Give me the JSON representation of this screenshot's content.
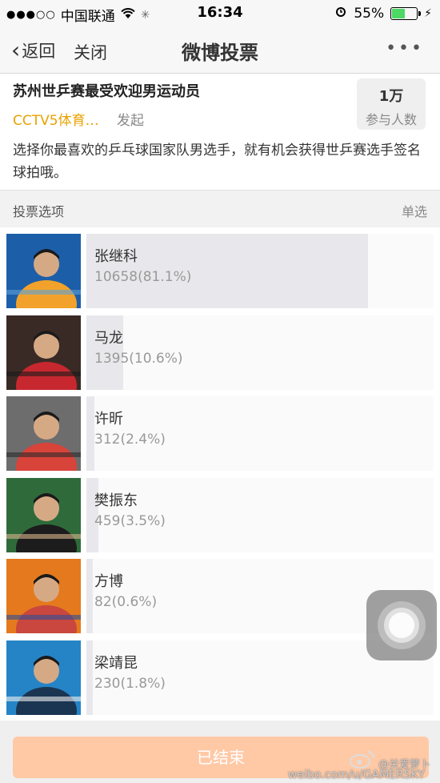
{
  "status_bar": {
    "carrier": "中国联通",
    "time": "16:34",
    "battery_percent": "55%",
    "battery_level": 0.55
  },
  "nav": {
    "back_label": "返回",
    "close_label": "关闭",
    "title": "微博投票",
    "more_label": "•••"
  },
  "poll": {
    "title": "苏州世乒赛最受欢迎男运动员",
    "publisher": "CCTV5体育…",
    "publish_verb": "发起",
    "participants_count": "1万",
    "participants_label": "参与人数",
    "description": "选择你最喜欢的乒乓球国家队男选手，就有机会获得世乒赛选手签名球拍哦。"
  },
  "section": {
    "label": "投票选项",
    "mode": "单选"
  },
  "options": [
    {
      "name": "张继科",
      "count": "10658(81.1%)",
      "fraction": 0.811,
      "colors": [
        "#1d5ea8",
        "#f2a22a",
        "#5aa0d8"
      ]
    },
    {
      "name": "马龙",
      "count": "1395(10.6%)",
      "fraction": 0.106,
      "colors": [
        "#3a2a25",
        "#c7282f",
        "#1a1a1a"
      ]
    },
    {
      "name": "许昕",
      "count": "312(2.4%)",
      "fraction": 0.024,
      "colors": [
        "#6d6d6d",
        "#d8433a",
        "#2b2b2b"
      ]
    },
    {
      "name": "樊振东",
      "count": "459(3.5%)",
      "fraction": 0.035,
      "colors": [
        "#2f6b3a",
        "#1c1c1c",
        "#d9b48c"
      ]
    },
    {
      "name": "方博",
      "count": "82(0.6%)",
      "fraction": 0.006,
      "colors": [
        "#e47a1d",
        "#c9473e",
        "#2d4f9a"
      ]
    },
    {
      "name": "梁靖昆",
      "count": "230(1.8%)",
      "fraction": 0.018,
      "colors": [
        "#2584c6",
        "#1a3552",
        "#f1f1f1"
      ]
    }
  ],
  "footer": {
    "end_label": "已结束"
  },
  "watermark": {
    "name": "@关爱萝卜",
    "url": "weibo.com/u/GAMERSKY"
  },
  "colors": {
    "accent": "#e8a200",
    "end_button": "#ffc9a6",
    "bar_fill": "#e8e8ec"
  }
}
